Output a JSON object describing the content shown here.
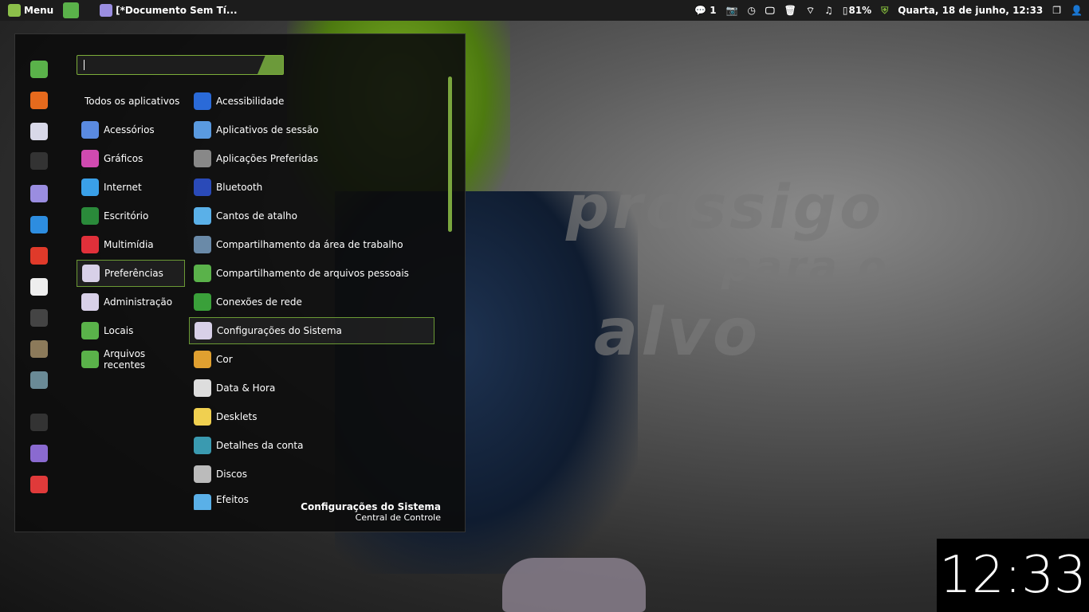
{
  "panel": {
    "menu_label": "Menu",
    "window_title": "[*Documento Sem Tí...",
    "notifications": "1",
    "battery": "81%",
    "datetime": "Quarta, 18 de junho, 12:33"
  },
  "wallpaper": {
    "lines": [
      "prossigo",
      "para o",
      "alvo"
    ]
  },
  "search": {
    "value": ""
  },
  "favorites": [
    {
      "icon": "files-icon",
      "color": "#5ab24a"
    },
    {
      "icon": "firefox-icon",
      "color": "#e66a1d"
    },
    {
      "icon": "settings-toggle-icon",
      "color": "#d8d8e8"
    },
    {
      "icon": "terminal-icon",
      "color": "#333"
    },
    {
      "icon": "text-editor-icon",
      "color": "#9a8de0"
    },
    {
      "icon": "download-icon",
      "color": "#2d8de0"
    },
    {
      "icon": "disc-icon",
      "color": "#e03a2a"
    },
    {
      "icon": "document-icon",
      "color": "#eee"
    },
    {
      "icon": "calculator-icon",
      "color": "#444"
    },
    {
      "icon": "gimp-icon",
      "color": "#8c7a5a"
    },
    {
      "icon": "drive-icon",
      "color": "#6a8a96"
    },
    {
      "icon": "lock-icon",
      "color": "#333"
    },
    {
      "icon": "logout-icon",
      "color": "#8a6ad0"
    },
    {
      "icon": "power-icon",
      "color": "#e03a3a"
    }
  ],
  "categories": [
    {
      "label": "Todos os aplicativos",
      "color": ""
    },
    {
      "label": "Acessórios",
      "color": "#5a8ae0"
    },
    {
      "label": "Gráficos",
      "color": "#d04ab0"
    },
    {
      "label": "Internet",
      "color": "#3aa0e8"
    },
    {
      "label": "Escritório",
      "color": "#2a8a3a"
    },
    {
      "label": "Multimídia",
      "color": "#e0303a"
    },
    {
      "label": "Preferências",
      "color": "#d8d0e8",
      "selected": true
    },
    {
      "label": "Administração",
      "color": "#d8d0e8"
    },
    {
      "label": "Locais",
      "color": "#5ab24a"
    },
    {
      "label": "Arquivos recentes",
      "color": "#5ab24a"
    }
  ],
  "apps": [
    {
      "label": "Acessibilidade",
      "color": "#2a6ad8"
    },
    {
      "label": "Aplicativos de sessão",
      "color": "#5a9ae0"
    },
    {
      "label": "Aplicações Preferidas",
      "color": "#888"
    },
    {
      "label": "Bluetooth",
      "color": "#2a4ab8"
    },
    {
      "label": "Cantos de atalho",
      "color": "#5ab0e8"
    },
    {
      "label": "Compartilhamento da área de trabalho",
      "color": "#6a8aa8"
    },
    {
      "label": "Compartilhamento de arquivos pessoais",
      "color": "#5ab24a"
    },
    {
      "label": "Conexões de rede",
      "color": "#3aa03a"
    },
    {
      "label": "Configurações do Sistema",
      "color": "#d8d0e8",
      "selected": true
    },
    {
      "label": "Cor",
      "color": "#e0a030"
    },
    {
      "label": "Data & Hora",
      "color": "#ddd"
    },
    {
      "label": "Desklets",
      "color": "#f0d050"
    },
    {
      "label": "Detalhes da conta",
      "color": "#3a9ab0"
    },
    {
      "label": "Discos",
      "color": "#bbb"
    },
    {
      "label": "Efeitos",
      "color": "#5ab0e8"
    }
  ],
  "description": {
    "title": "Configurações do Sistema",
    "subtitle": "Central de Controle"
  },
  "clock": "12:33",
  "accent": "#7cae3a"
}
